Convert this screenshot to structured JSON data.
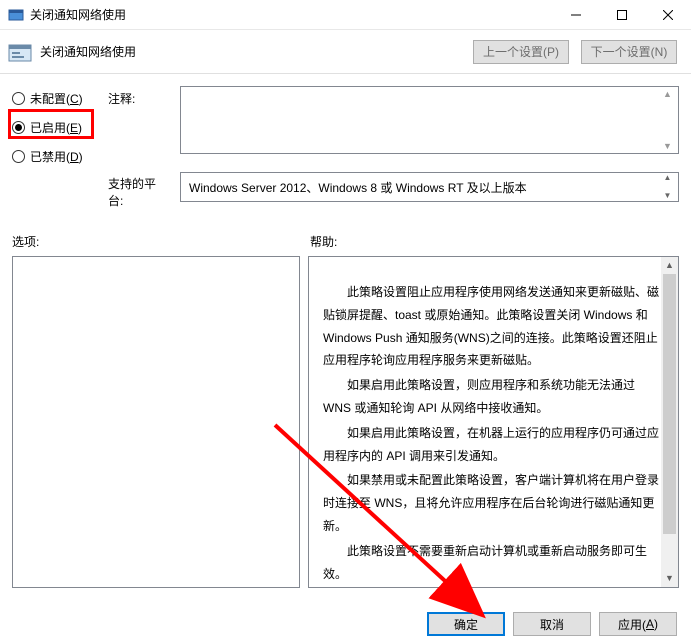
{
  "window": {
    "title": "关闭通知网络使用"
  },
  "header": {
    "title": "关闭通知网络使用",
    "prev_label": "上一个设置(P)",
    "next_label": "下一个设置(N)"
  },
  "radios": {
    "not_configured": {
      "label": "未配置(",
      "key": "C",
      "suffix": ")"
    },
    "enabled": {
      "label": "已启用(",
      "key": "E",
      "suffix": ")"
    },
    "disabled": {
      "label": "已禁用(",
      "key": "D",
      "suffix": ")"
    },
    "selected": "enabled"
  },
  "labels": {
    "comment": "注释:",
    "platform": "支持的平台:",
    "options": "选项:",
    "help": "帮助:"
  },
  "platform_text": "Windows Server 2012、Windows 8 或 Windows RT 及以上版本",
  "help": {
    "p1": "此策略设置阻止应用程序使用网络发送通知来更新磁贴、磁贴锁屏提醒、toast 或原始通知。此策略设置关闭 Windows 和 Windows Push 通知服务(WNS)之间的连接。此策略设置还阻止应用程序轮询应用程序服务来更新磁贴。",
    "p2": "如果启用此策略设置，则应用程序和系统功能无法通过 WNS 或通知轮询 API 从网络中接收通知。",
    "p3": "如果启用此策略设置，在机器上运行的应用程序仍可通过应用程序内的 API 调用来引发通知。",
    "p4": "如果禁用或未配置此策略设置，客户端计算机将在用户登录时连接至 WNS，且将允许应用程序在后台轮询进行磁贴通知更新。",
    "p5": "此策略设置不需要重新启动计算机或重新启动服务即可生效。"
  },
  "buttons": {
    "ok": "确定",
    "cancel": "取消",
    "apply_label": "应用(",
    "apply_key": "A",
    "apply_suffix": ")"
  }
}
